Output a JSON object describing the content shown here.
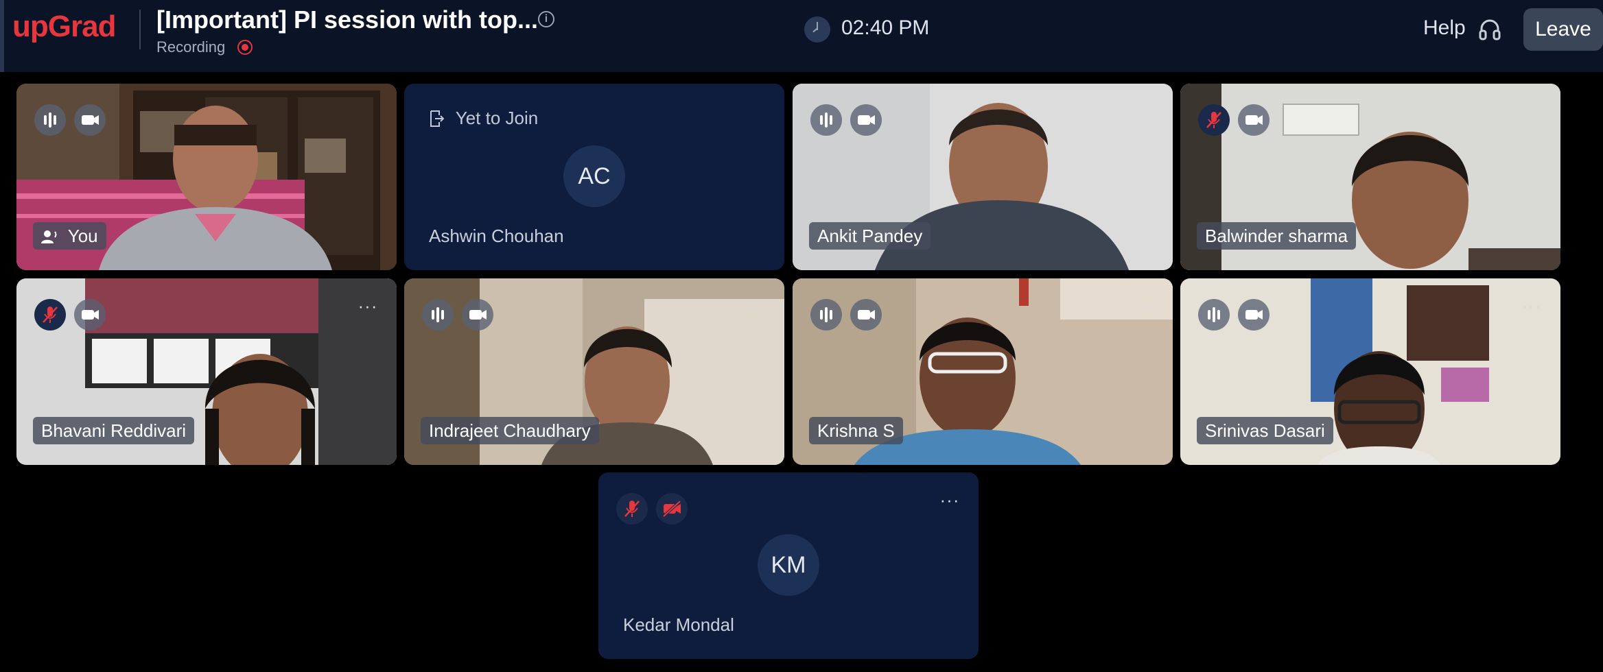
{
  "header": {
    "logo": "upGrad",
    "title": "[Important] PI session with top...",
    "recording_label": "Recording",
    "time": "02:40 PM",
    "help_label": "Help",
    "leave_label": "Leave"
  },
  "tiles": [
    {
      "name": "You",
      "type": "video",
      "mic": "on",
      "camera": "on"
    },
    {
      "name": "Ashwin Chouhan",
      "type": "avatar",
      "initials": "AC",
      "status": "Yet to Join"
    },
    {
      "name": "Ankit Pandey",
      "type": "video",
      "mic": "on",
      "camera": "on"
    },
    {
      "name": "Balwinder sharma",
      "type": "video",
      "mic": "muted",
      "camera": "on"
    },
    {
      "name": "Bhavani Reddivari",
      "type": "video",
      "mic": "muted",
      "camera": "on"
    },
    {
      "name": "Indrajeet Chaudhary",
      "type": "video",
      "mic": "on",
      "camera": "on"
    },
    {
      "name": "Krishna S",
      "type": "video",
      "mic": "on",
      "camera": "on"
    },
    {
      "name": "Srinivas Dasari",
      "type": "video",
      "mic": "on",
      "camera": "on"
    },
    {
      "name": "Kedar Mondal",
      "type": "avatar",
      "initials": "KM",
      "mic": "muted",
      "camera": "off"
    }
  ],
  "more_label": "···",
  "colors": {
    "brand": "#e8363f",
    "header_bg": "#0b1326",
    "tile_bg": "#0e1c3d",
    "muted": "#e8363f"
  }
}
